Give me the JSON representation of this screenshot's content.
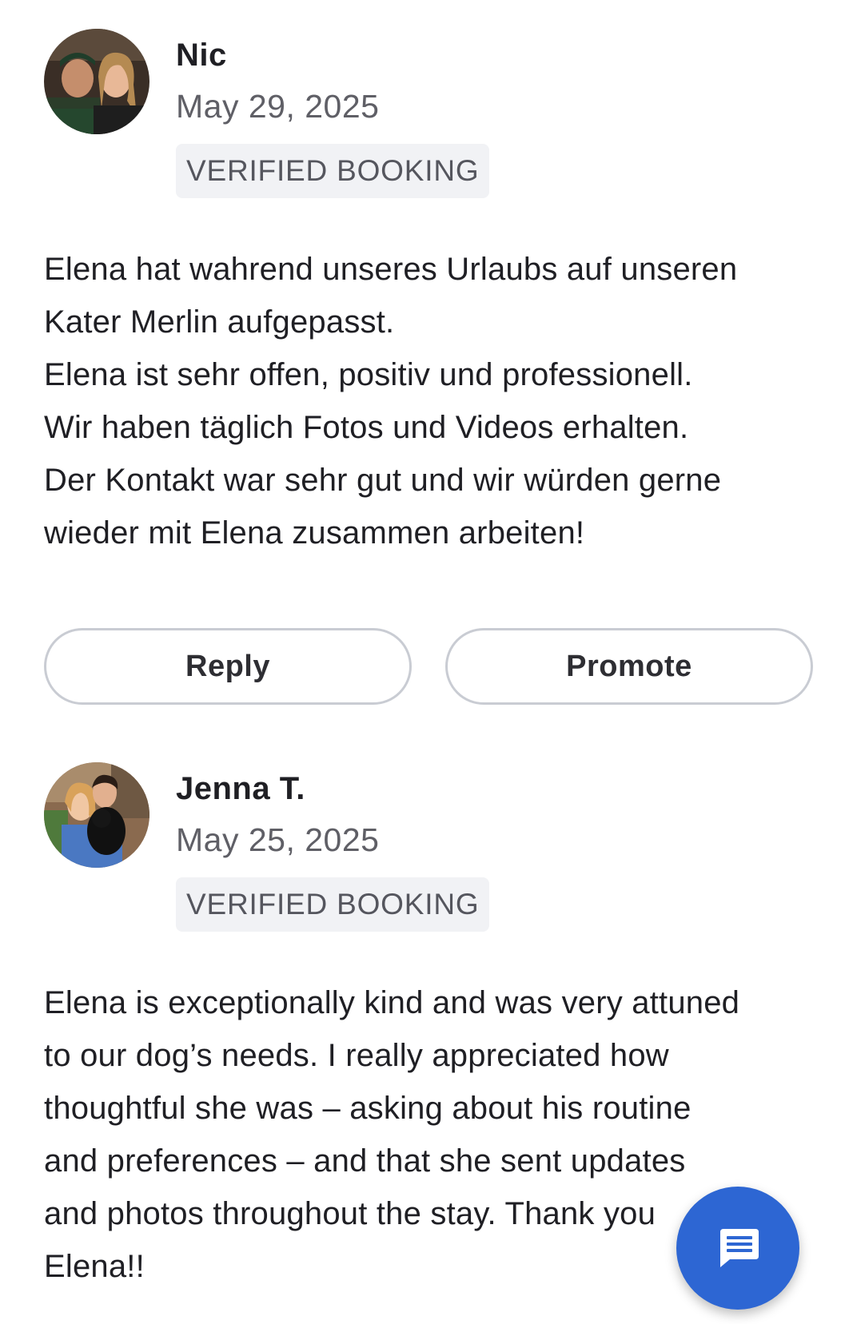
{
  "reviews": [
    {
      "author": "Nic",
      "date": "May 29, 2025",
      "badge": "VERIFIED BOOKING",
      "text": "Elena hat wahrend unseres Urlaubs auf unseren\nKater Merlin aufgepasst.\nElena ist sehr offen, positiv und professionell.\nWir haben täglich Fotos und Videos erhalten.\nDer Kontakt war sehr gut und wir würden gerne\nwieder mit Elena zusammen arbeiten!"
    },
    {
      "author": "Jenna T.",
      "date": "May 25, 2025",
      "badge": "VERIFIED BOOKING",
      "text": "Elena is exceptionally kind and was very attuned\nto our dog’s needs. I really appreciated how\nthoughtful she was – asking about his routine\nand preferences – and that she sent updates\nand photos throughout the stay. Thank you\nElena!!"
    }
  ],
  "actions": {
    "reply_label": "Reply",
    "promote_label": "Promote"
  },
  "fab": {
    "icon": "chat-icon",
    "color": "#2d66d3"
  }
}
